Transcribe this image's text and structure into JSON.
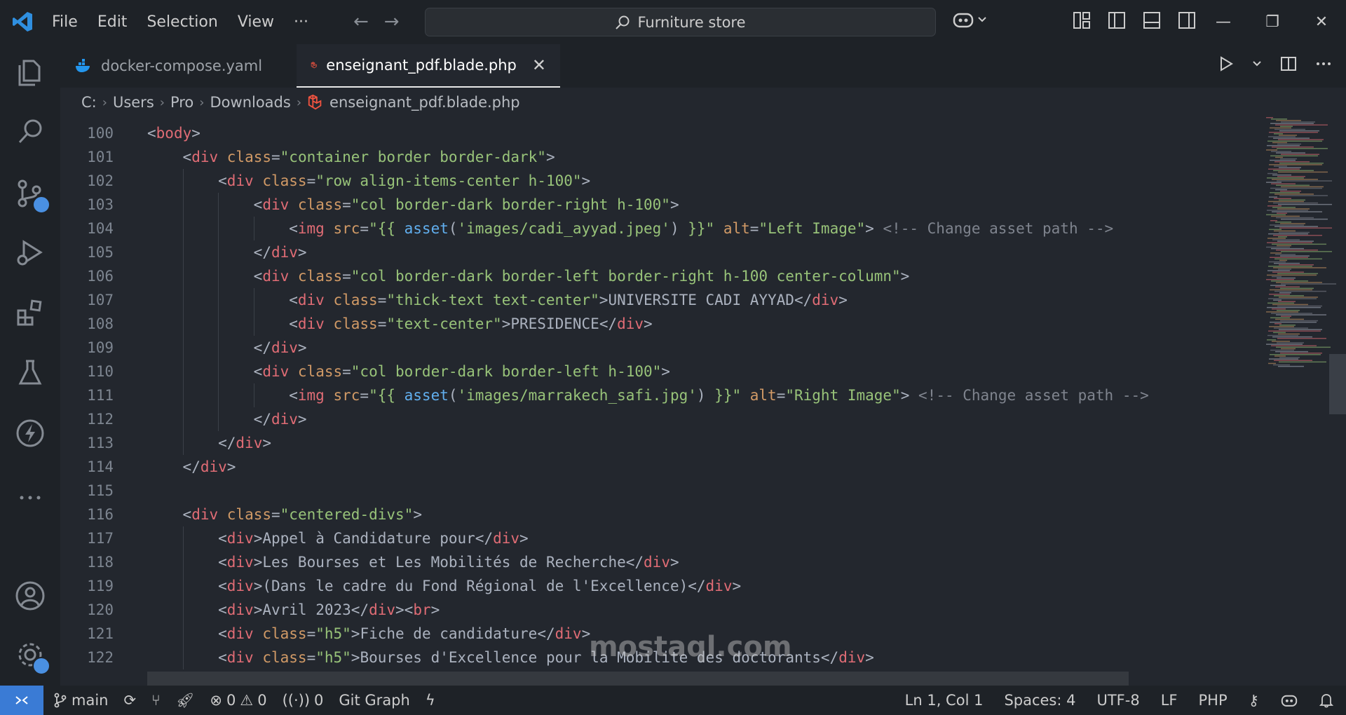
{
  "menu": [
    "File",
    "Edit",
    "Selection",
    "View",
    "···"
  ],
  "search": {
    "label": "Furniture store"
  },
  "window": {
    "minimize": "—",
    "restore": "❐",
    "close": "✕"
  },
  "tabs": [
    {
      "label": "docker-compose.yaml",
      "active": false
    },
    {
      "label": "enseignant_pdf.blade.php",
      "active": true
    }
  ],
  "breadcrumb": [
    "C:",
    "Users",
    "Pro",
    "Downloads",
    "enseignant_pdf.blade.php"
  ],
  "code": [
    {
      "n": "100",
      "i": 0,
      "t": [
        [
          "t-punc",
          "<"
        ],
        [
          "t-tag",
          "body"
        ],
        [
          "t-punc",
          ">"
        ]
      ]
    },
    {
      "n": "101",
      "i": 1,
      "t": [
        [
          "t-punc",
          "<"
        ],
        [
          "t-tag",
          "div"
        ],
        [
          "t-attr",
          " class"
        ],
        [
          "t-punc",
          "="
        ],
        [
          "t-str",
          "\"container border border-dark\""
        ],
        [
          "t-punc",
          ">"
        ]
      ]
    },
    {
      "n": "102",
      "i": 2,
      "t": [
        [
          "t-punc",
          "<"
        ],
        [
          "t-tag",
          "div"
        ],
        [
          "t-attr",
          " class"
        ],
        [
          "t-punc",
          "="
        ],
        [
          "t-str",
          "\"row align-items-center h-100\""
        ],
        [
          "t-punc",
          ">"
        ]
      ]
    },
    {
      "n": "103",
      "i": 3,
      "t": [
        [
          "t-punc",
          "<"
        ],
        [
          "t-tag",
          "div"
        ],
        [
          "t-attr",
          " class"
        ],
        [
          "t-punc",
          "="
        ],
        [
          "t-str",
          "\"col border-dark border-right h-100\""
        ],
        [
          "t-punc",
          ">"
        ]
      ]
    },
    {
      "n": "104",
      "i": 4,
      "t": [
        [
          "t-punc",
          "<"
        ],
        [
          "t-tag",
          "img"
        ],
        [
          "t-attr",
          " src"
        ],
        [
          "t-punc",
          "="
        ],
        [
          "t-str",
          "\"{{ "
        ],
        [
          "t-fn",
          "asset"
        ],
        [
          "t-punc",
          "("
        ],
        [
          "t-str",
          "'images/cadi_ayyad.jpeg'"
        ],
        [
          "t-punc",
          ")"
        ],
        [
          "t-str",
          " }}\""
        ],
        [
          "t-attr",
          " alt"
        ],
        [
          "t-punc",
          "="
        ],
        [
          "t-str",
          "\"Left Image\""
        ],
        [
          "t-punc",
          ">"
        ],
        [
          "t-cm",
          " <!-- Change asset path -->"
        ]
      ]
    },
    {
      "n": "105",
      "i": 3,
      "t": [
        [
          "t-punc",
          "</"
        ],
        [
          "t-tag",
          "div"
        ],
        [
          "t-punc",
          ">"
        ]
      ]
    },
    {
      "n": "106",
      "i": 3,
      "t": [
        [
          "t-punc",
          "<"
        ],
        [
          "t-tag",
          "div"
        ],
        [
          "t-attr",
          " class"
        ],
        [
          "t-punc",
          "="
        ],
        [
          "t-str",
          "\"col border-dark border-left border-right h-100 center-column\""
        ],
        [
          "t-punc",
          ">"
        ]
      ]
    },
    {
      "n": "107",
      "i": 4,
      "t": [
        [
          "t-punc",
          "<"
        ],
        [
          "t-tag",
          "div"
        ],
        [
          "t-attr",
          " class"
        ],
        [
          "t-punc",
          "="
        ],
        [
          "t-str",
          "\"thick-text text-center\""
        ],
        [
          "t-punc",
          ">"
        ],
        [
          "t-txt",
          "UNIVERSITE CADI AYYAD"
        ],
        [
          "t-punc",
          "</"
        ],
        [
          "t-tag",
          "div"
        ],
        [
          "t-punc",
          ">"
        ]
      ]
    },
    {
      "n": "108",
      "i": 4,
      "t": [
        [
          "t-punc",
          "<"
        ],
        [
          "t-tag",
          "div"
        ],
        [
          "t-attr",
          " class"
        ],
        [
          "t-punc",
          "="
        ],
        [
          "t-str",
          "\"text-center\""
        ],
        [
          "t-punc",
          ">"
        ],
        [
          "t-txt",
          "PRESIDENCE"
        ],
        [
          "t-punc",
          "</"
        ],
        [
          "t-tag",
          "div"
        ],
        [
          "t-punc",
          ">"
        ]
      ]
    },
    {
      "n": "109",
      "i": 3,
      "t": [
        [
          "t-punc",
          "</"
        ],
        [
          "t-tag",
          "div"
        ],
        [
          "t-punc",
          ">"
        ]
      ]
    },
    {
      "n": "110",
      "i": 3,
      "t": [
        [
          "t-punc",
          "<"
        ],
        [
          "t-tag",
          "div"
        ],
        [
          "t-attr",
          " class"
        ],
        [
          "t-punc",
          "="
        ],
        [
          "t-str",
          "\"col border-dark border-left h-100\""
        ],
        [
          "t-punc",
          ">"
        ]
      ]
    },
    {
      "n": "111",
      "i": 4,
      "t": [
        [
          "t-punc",
          "<"
        ],
        [
          "t-tag",
          "img"
        ],
        [
          "t-attr",
          " src"
        ],
        [
          "t-punc",
          "="
        ],
        [
          "t-str",
          "\"{{ "
        ],
        [
          "t-fn",
          "asset"
        ],
        [
          "t-punc",
          "("
        ],
        [
          "t-str",
          "'images/marrakech_safi.jpg'"
        ],
        [
          "t-punc",
          ")"
        ],
        [
          "t-str",
          " }}\""
        ],
        [
          "t-attr",
          " alt"
        ],
        [
          "t-punc",
          "="
        ],
        [
          "t-str",
          "\"Right Image\""
        ],
        [
          "t-punc",
          ">"
        ],
        [
          "t-cm",
          " <!-- Change asset path -->"
        ]
      ]
    },
    {
      "n": "112",
      "i": 3,
      "t": [
        [
          "t-punc",
          "</"
        ],
        [
          "t-tag",
          "div"
        ],
        [
          "t-punc",
          ">"
        ]
      ]
    },
    {
      "n": "113",
      "i": 2,
      "t": [
        [
          "t-punc",
          "</"
        ],
        [
          "t-tag",
          "div"
        ],
        [
          "t-punc",
          ">"
        ]
      ]
    },
    {
      "n": "114",
      "i": 1,
      "t": [
        [
          "t-punc",
          "</"
        ],
        [
          "t-tag",
          "div"
        ],
        [
          "t-punc",
          ">"
        ]
      ]
    },
    {
      "n": "115",
      "i": 0,
      "t": []
    },
    {
      "n": "116",
      "i": 1,
      "t": [
        [
          "t-punc",
          "<"
        ],
        [
          "t-tag",
          "div"
        ],
        [
          "t-attr",
          " class"
        ],
        [
          "t-punc",
          "="
        ],
        [
          "t-str",
          "\"centered-divs\""
        ],
        [
          "t-punc",
          ">"
        ]
      ]
    },
    {
      "n": "117",
      "i": 2,
      "t": [
        [
          "t-punc",
          "<"
        ],
        [
          "t-tag",
          "div"
        ],
        [
          "t-punc",
          ">"
        ],
        [
          "t-txt",
          "Appel à Candidature pour"
        ],
        [
          "t-punc",
          "</"
        ],
        [
          "t-tag",
          "div"
        ],
        [
          "t-punc",
          ">"
        ]
      ]
    },
    {
      "n": "118",
      "i": 2,
      "t": [
        [
          "t-punc",
          "<"
        ],
        [
          "t-tag",
          "div"
        ],
        [
          "t-punc",
          ">"
        ],
        [
          "t-txt",
          "Les Bourses et Les Mobilités de Recherche"
        ],
        [
          "t-punc",
          "</"
        ],
        [
          "t-tag",
          "div"
        ],
        [
          "t-punc",
          ">"
        ]
      ]
    },
    {
      "n": "119",
      "i": 2,
      "t": [
        [
          "t-punc",
          "<"
        ],
        [
          "t-tag",
          "div"
        ],
        [
          "t-punc",
          ">"
        ],
        [
          "t-txt",
          "(Dans le cadre du Fond Régional de l'Excellence)"
        ],
        [
          "t-punc",
          "</"
        ],
        [
          "t-tag",
          "div"
        ],
        [
          "t-punc",
          ">"
        ]
      ]
    },
    {
      "n": "120",
      "i": 2,
      "t": [
        [
          "t-punc",
          "<"
        ],
        [
          "t-tag",
          "div"
        ],
        [
          "t-punc",
          ">"
        ],
        [
          "t-txt",
          "Avril 2023"
        ],
        [
          "t-punc",
          "</"
        ],
        [
          "t-tag",
          "div"
        ],
        [
          "t-punc",
          "><"
        ],
        [
          "t-tag",
          "br"
        ],
        [
          "t-punc",
          ">"
        ]
      ]
    },
    {
      "n": "121",
      "i": 2,
      "t": [
        [
          "t-punc",
          "<"
        ],
        [
          "t-tag",
          "div"
        ],
        [
          "t-attr",
          " class"
        ],
        [
          "t-punc",
          "="
        ],
        [
          "t-str",
          "\"h5\""
        ],
        [
          "t-punc",
          ">"
        ],
        [
          "t-txt",
          "Fiche de candidature"
        ],
        [
          "t-punc",
          "</"
        ],
        [
          "t-tag",
          "div"
        ],
        [
          "t-punc",
          ">"
        ]
      ]
    },
    {
      "n": "122",
      "i": 2,
      "t": [
        [
          "t-punc",
          "<"
        ],
        [
          "t-tag",
          "div"
        ],
        [
          "t-attr",
          " class"
        ],
        [
          "t-punc",
          "="
        ],
        [
          "t-str",
          "\"h5\""
        ],
        [
          "t-punc",
          ">"
        ],
        [
          "t-txt",
          "Bourses d'Excellence pour la Mobilite des doctorants"
        ],
        [
          "t-punc",
          "</"
        ],
        [
          "t-tag",
          "div"
        ],
        [
          "t-punc",
          ">"
        ]
      ]
    }
  ],
  "status": {
    "branch": "main",
    "errors": "0",
    "warnings": "0",
    "ports": "0",
    "git_graph": "Git Graph",
    "position": "Ln 1, Col 1",
    "spaces": "Spaces: 4",
    "encoding": "UTF-8",
    "eol": "LF",
    "language": "PHP"
  },
  "watermark": "mostaql.com",
  "colors": {
    "accent": "#3a7bd5",
    "tag": "#e06c75",
    "attr": "#d19a66",
    "string": "#98c379",
    "function": "#61afef",
    "comment": "#7f848e"
  }
}
